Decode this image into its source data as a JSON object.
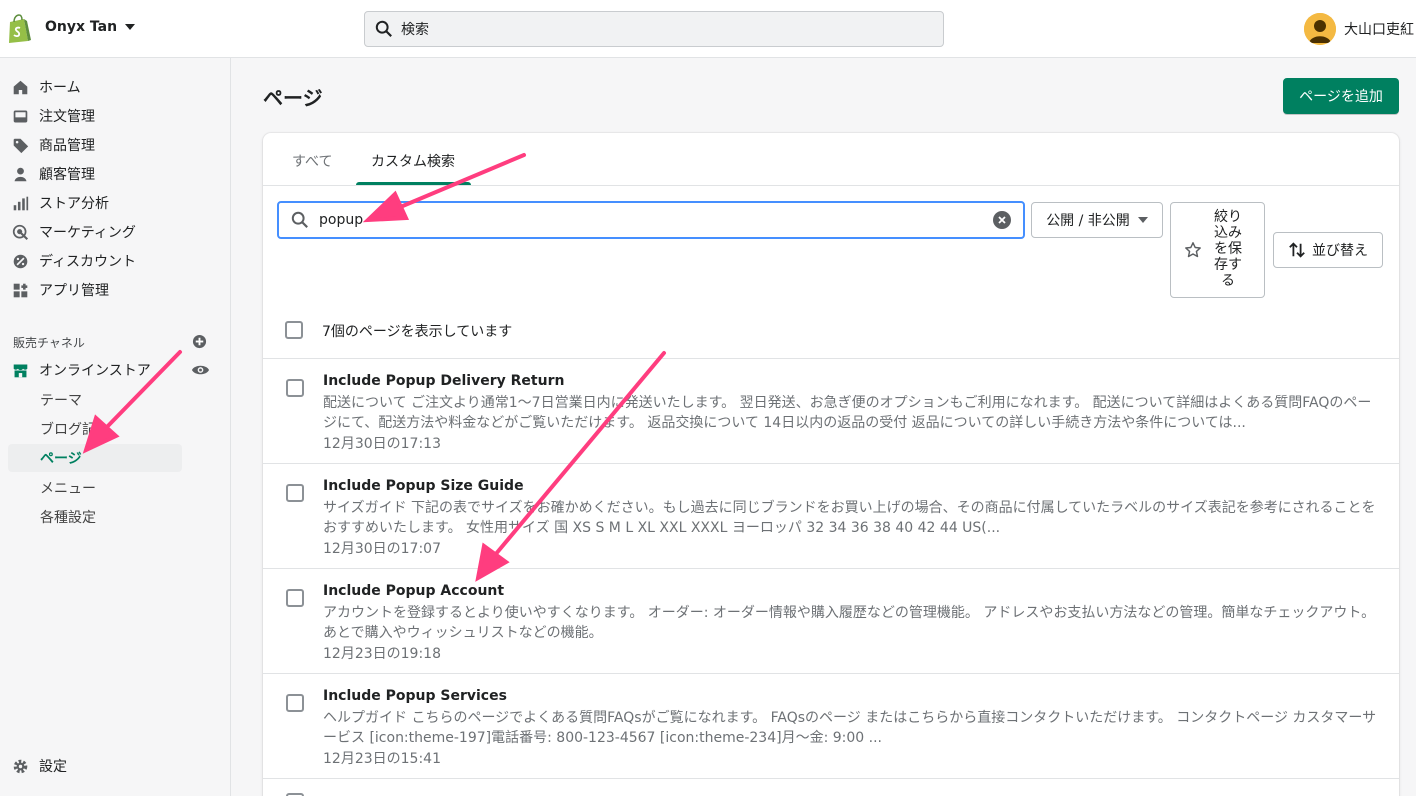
{
  "topbar": {
    "store_name": "Onyx Tan",
    "search_placeholder": "検索",
    "user_name": "大山口吏紅"
  },
  "sidebar": {
    "items": [
      {
        "label": "ホーム",
        "icon": "home-icon"
      },
      {
        "label": "注文管理",
        "icon": "inbox-icon"
      },
      {
        "label": "商品管理",
        "icon": "tag-icon"
      },
      {
        "label": "顧客管理",
        "icon": "person-icon"
      },
      {
        "label": "ストア分析",
        "icon": "bar-chart-icon"
      },
      {
        "label": "マーケティング",
        "icon": "target-icon"
      },
      {
        "label": "ディスカウント",
        "icon": "discount-icon"
      },
      {
        "label": "アプリ管理",
        "icon": "apps-icon"
      }
    ],
    "channels_label": "販売チャネル",
    "online_store": "オンラインストア",
    "sub_items": [
      "テーマ",
      "ブログ記",
      "ページ",
      "メニュー",
      "各種設定"
    ],
    "settings": "設定"
  },
  "main": {
    "title": "ページ",
    "add_button": "ページを追加",
    "tabs": [
      "すべて",
      "カスタム検索"
    ],
    "search_value": "popup",
    "filter_button": "公開 / 非公開",
    "save_button": "絞り込みを保存する",
    "save_button_lines": [
      "絞り",
      "込み",
      "を保",
      "存す",
      "る"
    ],
    "sort_button": "並び替え",
    "count_label": "7個のページを表示しています",
    "rows": [
      {
        "title": "Include Popup Delivery Return",
        "description": "配送について ご注文より通常1〜7日営業日内に発送いたします。 翌日発送、お急ぎ便のオプションもご利用になれます。 配送について詳細はよくある質問FAQのページにて、配送方法や料金などがご覧いただけます。 返品交換について 14日以内の返品の受付 返品についての詳しい手続き方法や条件については...",
        "date": "12月30日の17:13"
      },
      {
        "title": "Include Popup Size Guide",
        "description": "サイズガイド 下記の表でサイズをお確かめください。もし過去に同じブランドをお買い上げの場合、その商品に付属していたラベルのサイズ表記を参考にされることをおすすめいたします。 女性用サイズ 国 XS S M L XL XXL XXXL ヨーロッパ 32 34 36 38 40 42 44 US(...",
        "date": "12月30日の17:07"
      },
      {
        "title": "Include Popup Account",
        "description": "アカウントを登録するとより使いやすくなります。 オーダー: オーダー情報や購入履歴などの管理機能。 アドレスやお支払い方法などの管理。簡単なチェックアウト。 あとで購入やウィッシュリストなどの機能。",
        "date": "12月23日の19:18"
      },
      {
        "title": "Include Popup Services",
        "description": "ヘルプガイド こちらのページでよくある質問FAQsがご覧になれます。 FAQsのページ またはこちらから直接コンタクトいただけます。 コンタクトページ カスタマーサービス [icon:theme-197]電話番号: 800-123-4567 [icon:theme-234]月〜金: 9:00 ...",
        "date": "12月23日の15:41"
      }
    ]
  },
  "colors": {
    "primary": "#008060",
    "focus": "#458fff",
    "annotation": "#ff3d7f"
  }
}
